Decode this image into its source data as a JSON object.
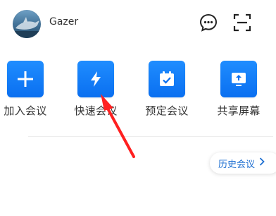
{
  "user": {
    "name": "Gazer"
  },
  "actions": [
    {
      "label": "加入会议",
      "icon": "plus-icon"
    },
    {
      "label": "快速会议",
      "icon": "lightning-icon"
    },
    {
      "label": "预定会议",
      "icon": "calendar-check-icon"
    },
    {
      "label": "共享屏幕",
      "icon": "share-screen-icon"
    }
  ],
  "history_button": {
    "label": "历史会议"
  },
  "colors": {
    "accent": "#0a6ff0",
    "annotation": "#ff2020",
    "link": "#1e6fd1"
  }
}
